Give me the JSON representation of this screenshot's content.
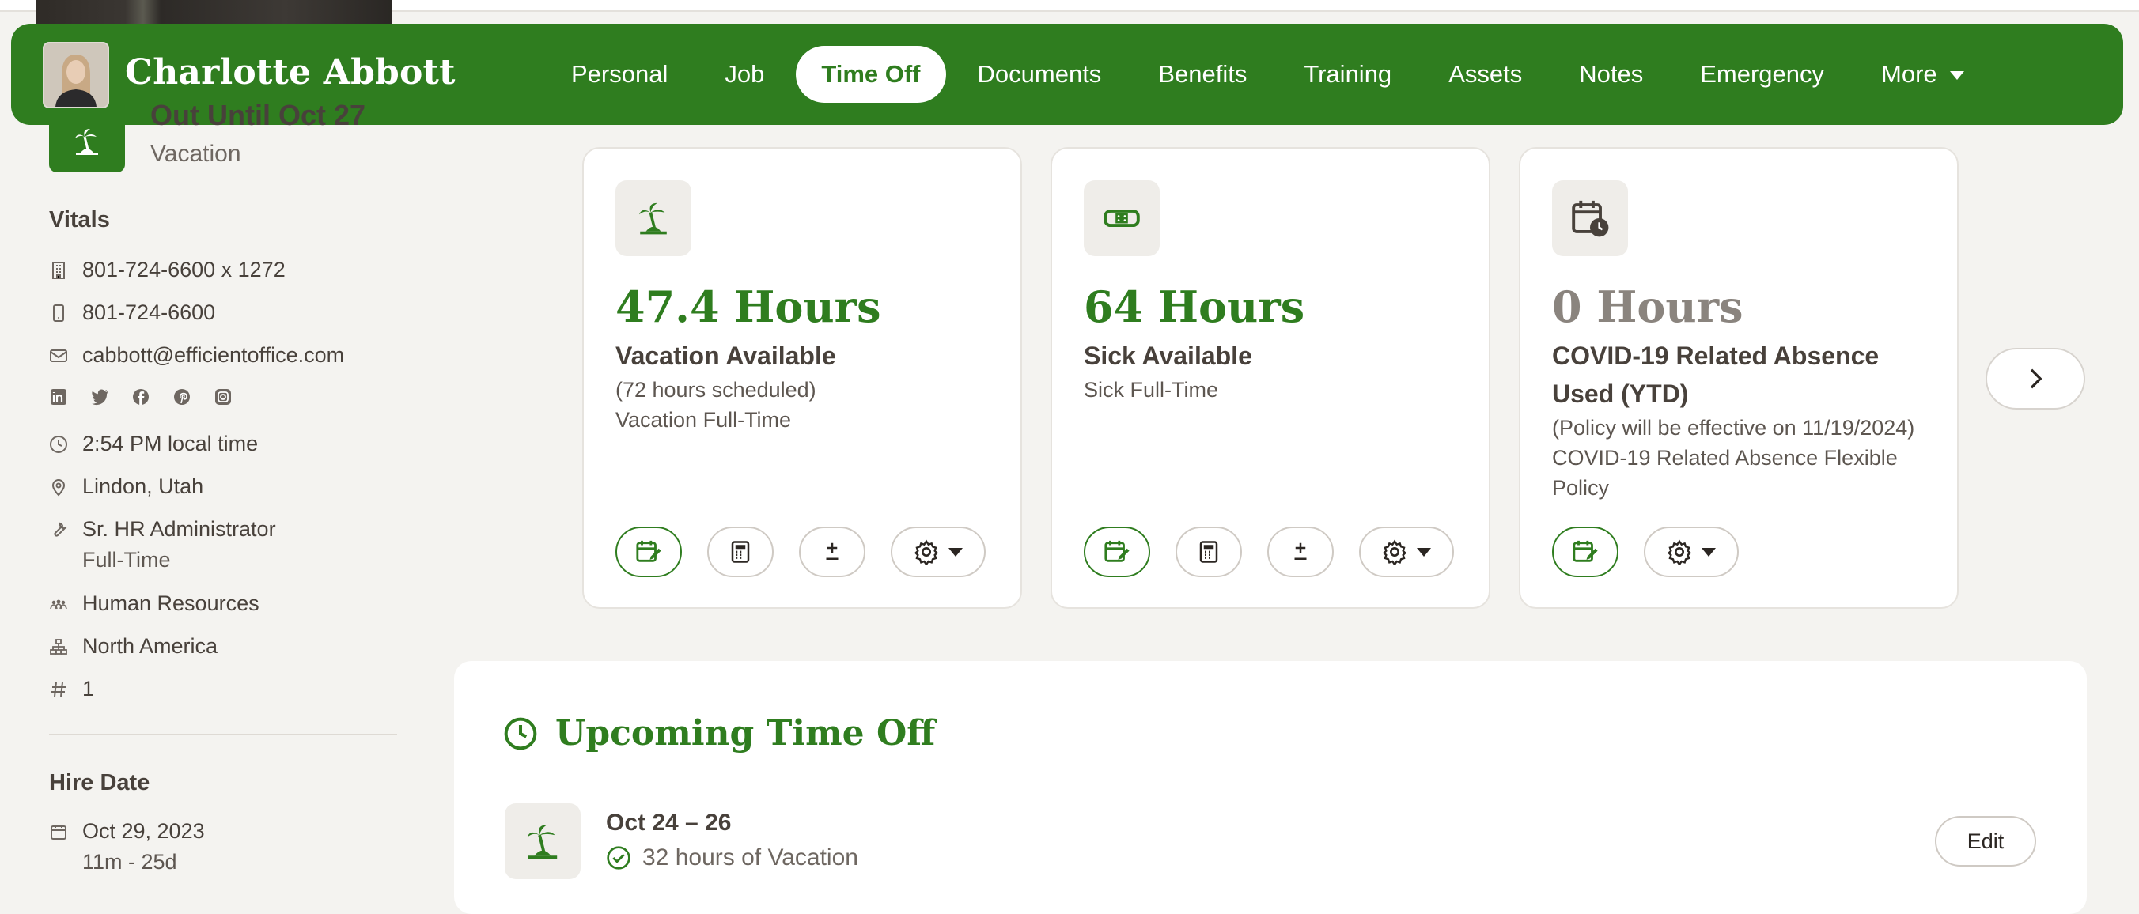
{
  "employee": {
    "name": "Charlotte Abbott",
    "avatar_alt": "Charlotte Abbott photo"
  },
  "nav": {
    "tabs": [
      {
        "label": "Personal"
      },
      {
        "label": "Job"
      },
      {
        "label": "Time Off",
        "active": true
      },
      {
        "label": "Documents"
      },
      {
        "label": "Benefits"
      },
      {
        "label": "Training"
      },
      {
        "label": "Assets"
      },
      {
        "label": "Notes"
      },
      {
        "label": "Emergency"
      },
      {
        "label": "More"
      }
    ]
  },
  "sidebar": {
    "status": {
      "title": "Out Until Oct 27",
      "subtitle": "Vacation"
    },
    "vitals_title": "Vitals",
    "work_phone": "801-724-6600 x 1272",
    "mobile_phone": "801-724-6600",
    "email": "cabbott@efficientoffice.com",
    "socials": [
      "linkedin-icon",
      "twitter-icon",
      "facebook-icon",
      "pinterest-icon",
      "instagram-icon"
    ],
    "local_time": "2:54 PM local time",
    "location": "Lindon, Utah",
    "job_title": "Sr. HR Administrator",
    "employment_type": "Full-Time",
    "department": "Human Resources",
    "division": "North America",
    "employee_number": "1",
    "hire_date_title": "Hire Date",
    "hire_date": "Oct 29, 2023",
    "tenure": "11m - 25d"
  },
  "cards": [
    {
      "hours": "47.4 Hours",
      "type": "Vacation Available",
      "lines": [
        "(72 hours scheduled)",
        "Vacation Full-Time"
      ],
      "icon": "palm-tree-icon"
    },
    {
      "hours": "64 Hours",
      "type": "Sick Available",
      "lines": [
        "Sick Full-Time"
      ],
      "icon": "bandage-icon"
    },
    {
      "hours": "0 Hours",
      "type": "COVID-19 Related Absence Used (YTD)",
      "lines": [
        "(Policy will be effective on 11/19/2024)",
        "COVID-19 Related Absence Flexible Policy"
      ],
      "icon": "calendar-clock-icon"
    }
  ],
  "upcoming": {
    "title": "Upcoming Time Off",
    "items": [
      {
        "date": "Oct 24 – 26",
        "detail": "32 hours of Vacation",
        "edit_label": "Edit"
      }
    ]
  },
  "colors": {
    "brand": "#2f7d1f",
    "background": "#f4f3f0",
    "text": "#48413b"
  }
}
